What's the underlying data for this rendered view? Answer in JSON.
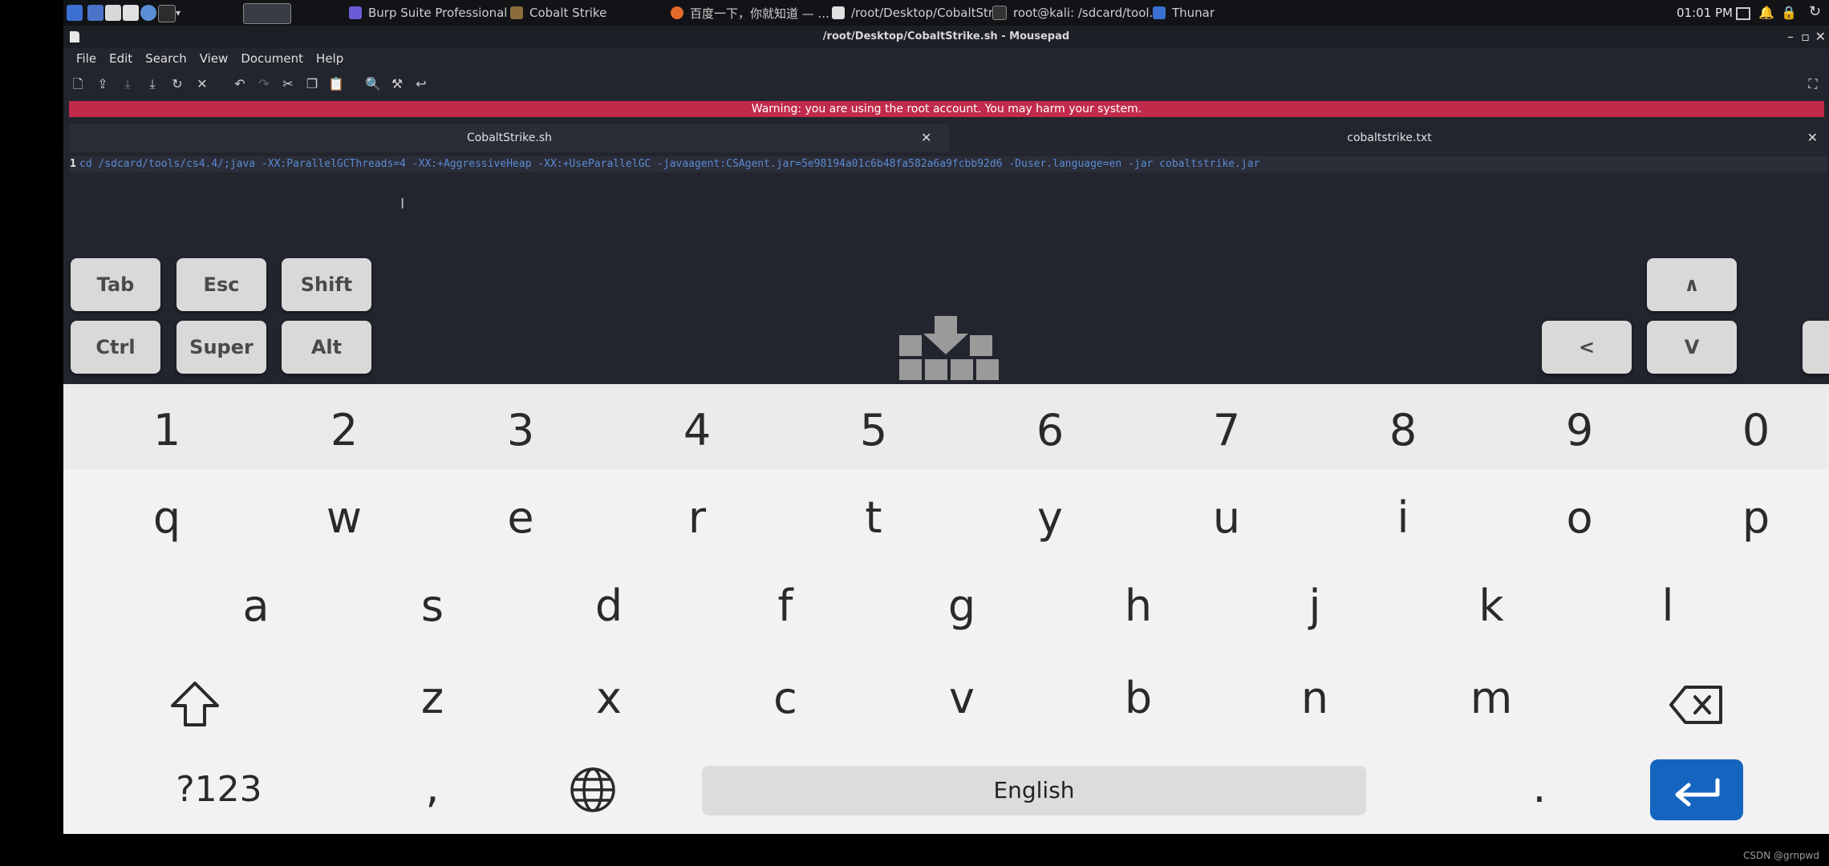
{
  "taskbar": {
    "tasks": [
      {
        "label": "Burp Suite Professional ..."
      },
      {
        "label": "Cobalt Strike"
      },
      {
        "label": "百度一下，你就知道 — ..."
      },
      {
        "label": "/root/Desktop/CobaltStr..."
      },
      {
        "label": "root@kali: /sdcard/tool..."
      },
      {
        "label": "Thunar"
      }
    ],
    "clock": "01:01 PM"
  },
  "window": {
    "title": "/root/Desktop/CobaltStrike.sh - Mousepad"
  },
  "menu": [
    "File",
    "Edit",
    "Search",
    "View",
    "Document",
    "Help"
  ],
  "warning": "Warning: you are using the root account. You may harm your system.",
  "tabs": [
    {
      "label": "CobaltStrike.sh"
    },
    {
      "label": "cobaltstrike.txt"
    }
  ],
  "editor": {
    "line_number": "1",
    "line_text": "cd /sdcard/tools/cs4.4/;java -XX:ParallelGCThreads=4 -XX:+AggressiveHeap -XX:+UseParallelGC -javaagent:CSAgent.jar=5e98194a01c6b48fa582a6a9fcbb92d6 -Duser.language=en -jar cobaltstrike.jar"
  },
  "extra_keys": {
    "tab": "Tab",
    "esc": "Esc",
    "shift": "Shift",
    "ctrl": "Ctrl",
    "super": "Super",
    "alt": "Alt",
    "up": "∧",
    "left": "<",
    "down": "V"
  },
  "keyboard": {
    "numbers": [
      "1",
      "2",
      "3",
      "4",
      "5",
      "6",
      "7",
      "8",
      "9",
      "0"
    ],
    "row1": [
      "q",
      "w",
      "e",
      "r",
      "t",
      "y",
      "u",
      "i",
      "o",
      "p"
    ],
    "row2": [
      "a",
      "s",
      "d",
      "f",
      "g",
      "h",
      "j",
      "k",
      "l"
    ],
    "row3": [
      "z",
      "x",
      "c",
      "v",
      "b",
      "n",
      "m"
    ],
    "symbols_label": "?123",
    "comma": ",",
    "space_label": "English",
    "period": "."
  },
  "watermark": "CSDN @grnpwd"
}
